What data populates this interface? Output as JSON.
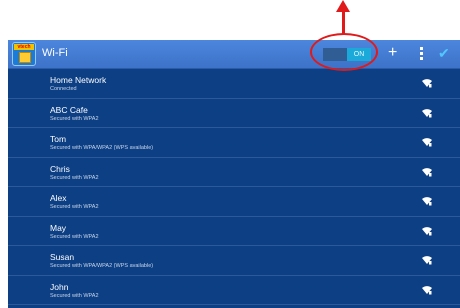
{
  "header": {
    "title": "Wi-Fi",
    "logo_text": "vtech",
    "toggle_label": "ON",
    "toggle_state": "on"
  },
  "icons": {
    "add": "plus-icon",
    "menu": "overflow-menu-icon",
    "done": "checkmark-icon",
    "signal": "wifi-signal-icon"
  },
  "networks": [
    {
      "name": "Home Network",
      "status": "Connected"
    },
    {
      "name": "ABC Cafe",
      "status": "Secured with WPA2"
    },
    {
      "name": "Tom",
      "status": "Secured with WPA/WPA2 (WPS available)"
    },
    {
      "name": "Chris",
      "status": "Secured with WPA2"
    },
    {
      "name": "Alex",
      "status": "Secured with WPA2"
    },
    {
      "name": "May",
      "status": "Secured with WPA2"
    },
    {
      "name": "Susan",
      "status": "Secured with WPA/WPA2 (WPS available)"
    },
    {
      "name": "John",
      "status": "Secured with WPA2"
    }
  ],
  "colors": {
    "list_bg": "#0d3f85",
    "header_bg": "#3d73c9",
    "annotation_red": "#e01a1a",
    "toggle_on": "#1aa9d8"
  }
}
